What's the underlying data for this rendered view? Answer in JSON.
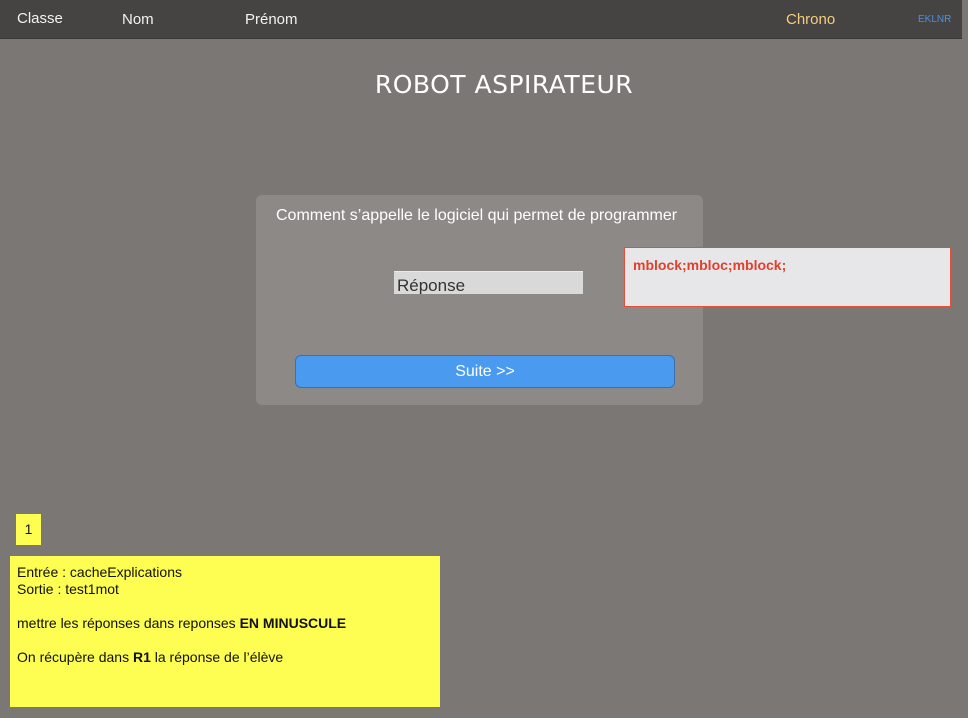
{
  "header": {
    "classe_label": "Classe",
    "nom_label": "Nom",
    "prenom_label": "Prénom",
    "chrono_label": "Chrono",
    "code_label": "EKLNR"
  },
  "page_title": "ROBOT ASPIRATEUR",
  "question": {
    "text": "Comment s’appelle le logiciel qui permet de programmer",
    "answer_placeholder": "Réponse",
    "answer_value": "",
    "next_button_label": "Suite >>"
  },
  "expected_answers": "mblock;mbloc;mblock;",
  "colors": {
    "background": "#7b7774",
    "header_bg": "#454443",
    "chrono": "#f3cf7a",
    "code": "#4a90e2",
    "button": "#4a9af0",
    "expected_text": "#e0402c",
    "note_bg": "#fdfd52"
  },
  "page_number": "1",
  "notes": {
    "line1": "Entrée : cacheExplications",
    "line2": "Sortie : test1mot",
    "line3_prefix": "mettre les réponses dans reponses  ",
    "line3_bold": "EN MINUSCULE",
    "line4_prefix": "On récupère dans ",
    "line4_bold": "R1",
    "line4_suffix": " la réponse de l’élève"
  }
}
